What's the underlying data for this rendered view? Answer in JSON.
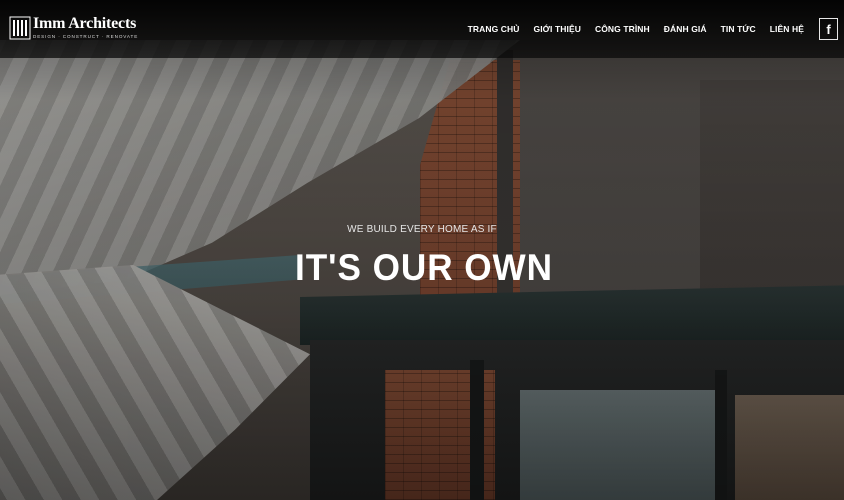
{
  "brand": {
    "name": "Imm Architects",
    "tagline": "DESIGN · CONSTRUCT · RENOVATE"
  },
  "nav": {
    "items": [
      {
        "label": "TRANG CHỦ"
      },
      {
        "label": "GIỚI THIỆU"
      },
      {
        "label": "CÔNG TRÌNH"
      },
      {
        "label": "ĐÁNH GIÁ"
      },
      {
        "label": "TIN TỨC"
      },
      {
        "label": "LIÊN HỆ"
      }
    ],
    "social_icon": "facebook-icon",
    "social_glyph": "f"
  },
  "hero": {
    "subtitle": "WE BUILD EVERY HOME AS IF",
    "title": "IT'S OUR OWN"
  },
  "colors": {
    "header_bg": "#0a0a0a",
    "text": "#ffffff"
  }
}
